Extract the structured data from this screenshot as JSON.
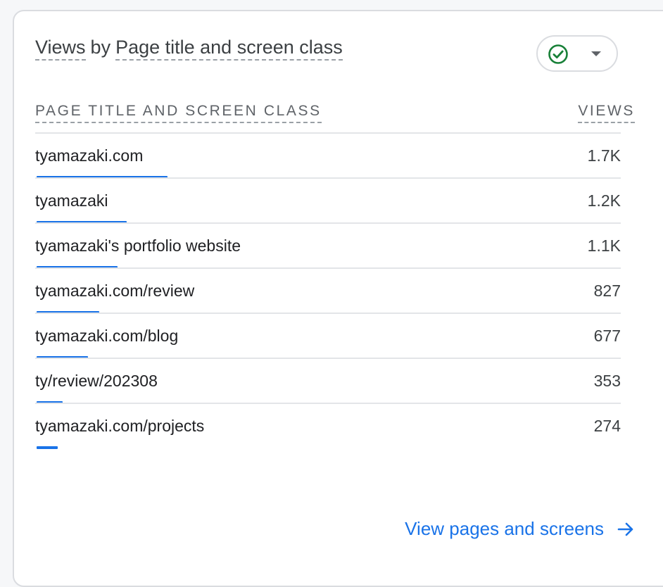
{
  "card": {
    "title_prefix": "Views",
    "title_by": "by",
    "title_dimension": "Page title and screen class",
    "status_icon": "check-circle-icon",
    "status_color": "#188038"
  },
  "table": {
    "column_dimension": "PAGE TITLE AND SCREEN CLASS",
    "column_metric": "VIEWS",
    "accent_color": "#1a73e8",
    "rows": [
      {
        "name": "tyamazaki.com",
        "value": "1.7K",
        "share": 1.0
      },
      {
        "name": "tyamazaki",
        "value": "1.2K",
        "share": 0.69
      },
      {
        "name": "tyamazaki's portfolio website",
        "value": "1.1K",
        "share": 0.62
      },
      {
        "name": "tyamazaki.com/review",
        "value": "827",
        "share": 0.48
      },
      {
        "name": "tyamazaki.com/blog",
        "value": "677",
        "share": 0.39
      },
      {
        "name": "ty/review/202308",
        "value": "353",
        "share": 0.2
      },
      {
        "name": "tyamazaki.com/projects",
        "value": "274",
        "share": 0.16
      }
    ]
  },
  "footer": {
    "link_label": "View pages and screens",
    "link_icon": "arrow-right-icon"
  }
}
